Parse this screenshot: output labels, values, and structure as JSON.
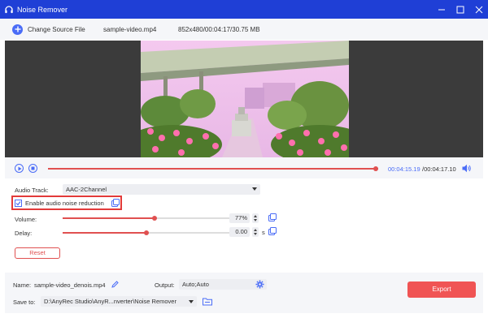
{
  "window": {
    "title": "Noise Remover",
    "logo_icon": "headphones-icon",
    "controls": [
      "minimize-icon",
      "maximize-icon",
      "close-icon"
    ]
  },
  "toolbar": {
    "change_source_label": "Change Source File",
    "filename": "sample-video.mp4",
    "file_info": "852x480/00:04:17/30.75 MB"
  },
  "playback": {
    "current_time": "00:04:15.19",
    "total_time": "/00:04:17.10",
    "progress": 0.993
  },
  "audio": {
    "track_label": "Audio Track:",
    "track_value": "AAC-2Channel",
    "noise_reduction_label": "Enable audio noise reduction",
    "noise_reduction_checked": true,
    "volume_label": "Volume:",
    "volume_value": "77%",
    "volume_level": 0.55,
    "delay_label": "Delay:",
    "delay_value": "0.00",
    "delay_unit": "s",
    "delay_level": 0.5,
    "reset_label": "Reset"
  },
  "output": {
    "name_label": "Name:",
    "name_value": "sample-video_denois.mp4",
    "output_label": "Output:",
    "output_value": "Auto;Auto",
    "save_label": "Save to:",
    "save_value": "D:\\AnyRec Studio\\AnyR...nverter\\Noise Remover",
    "export_label": "Export"
  },
  "colors": {
    "titlebar": "#1f3fd6",
    "accent_blue": "#4a6cf7",
    "accent_red": "#e05050",
    "highlight_border": "#e23a3a",
    "export_button": "#f05454"
  }
}
